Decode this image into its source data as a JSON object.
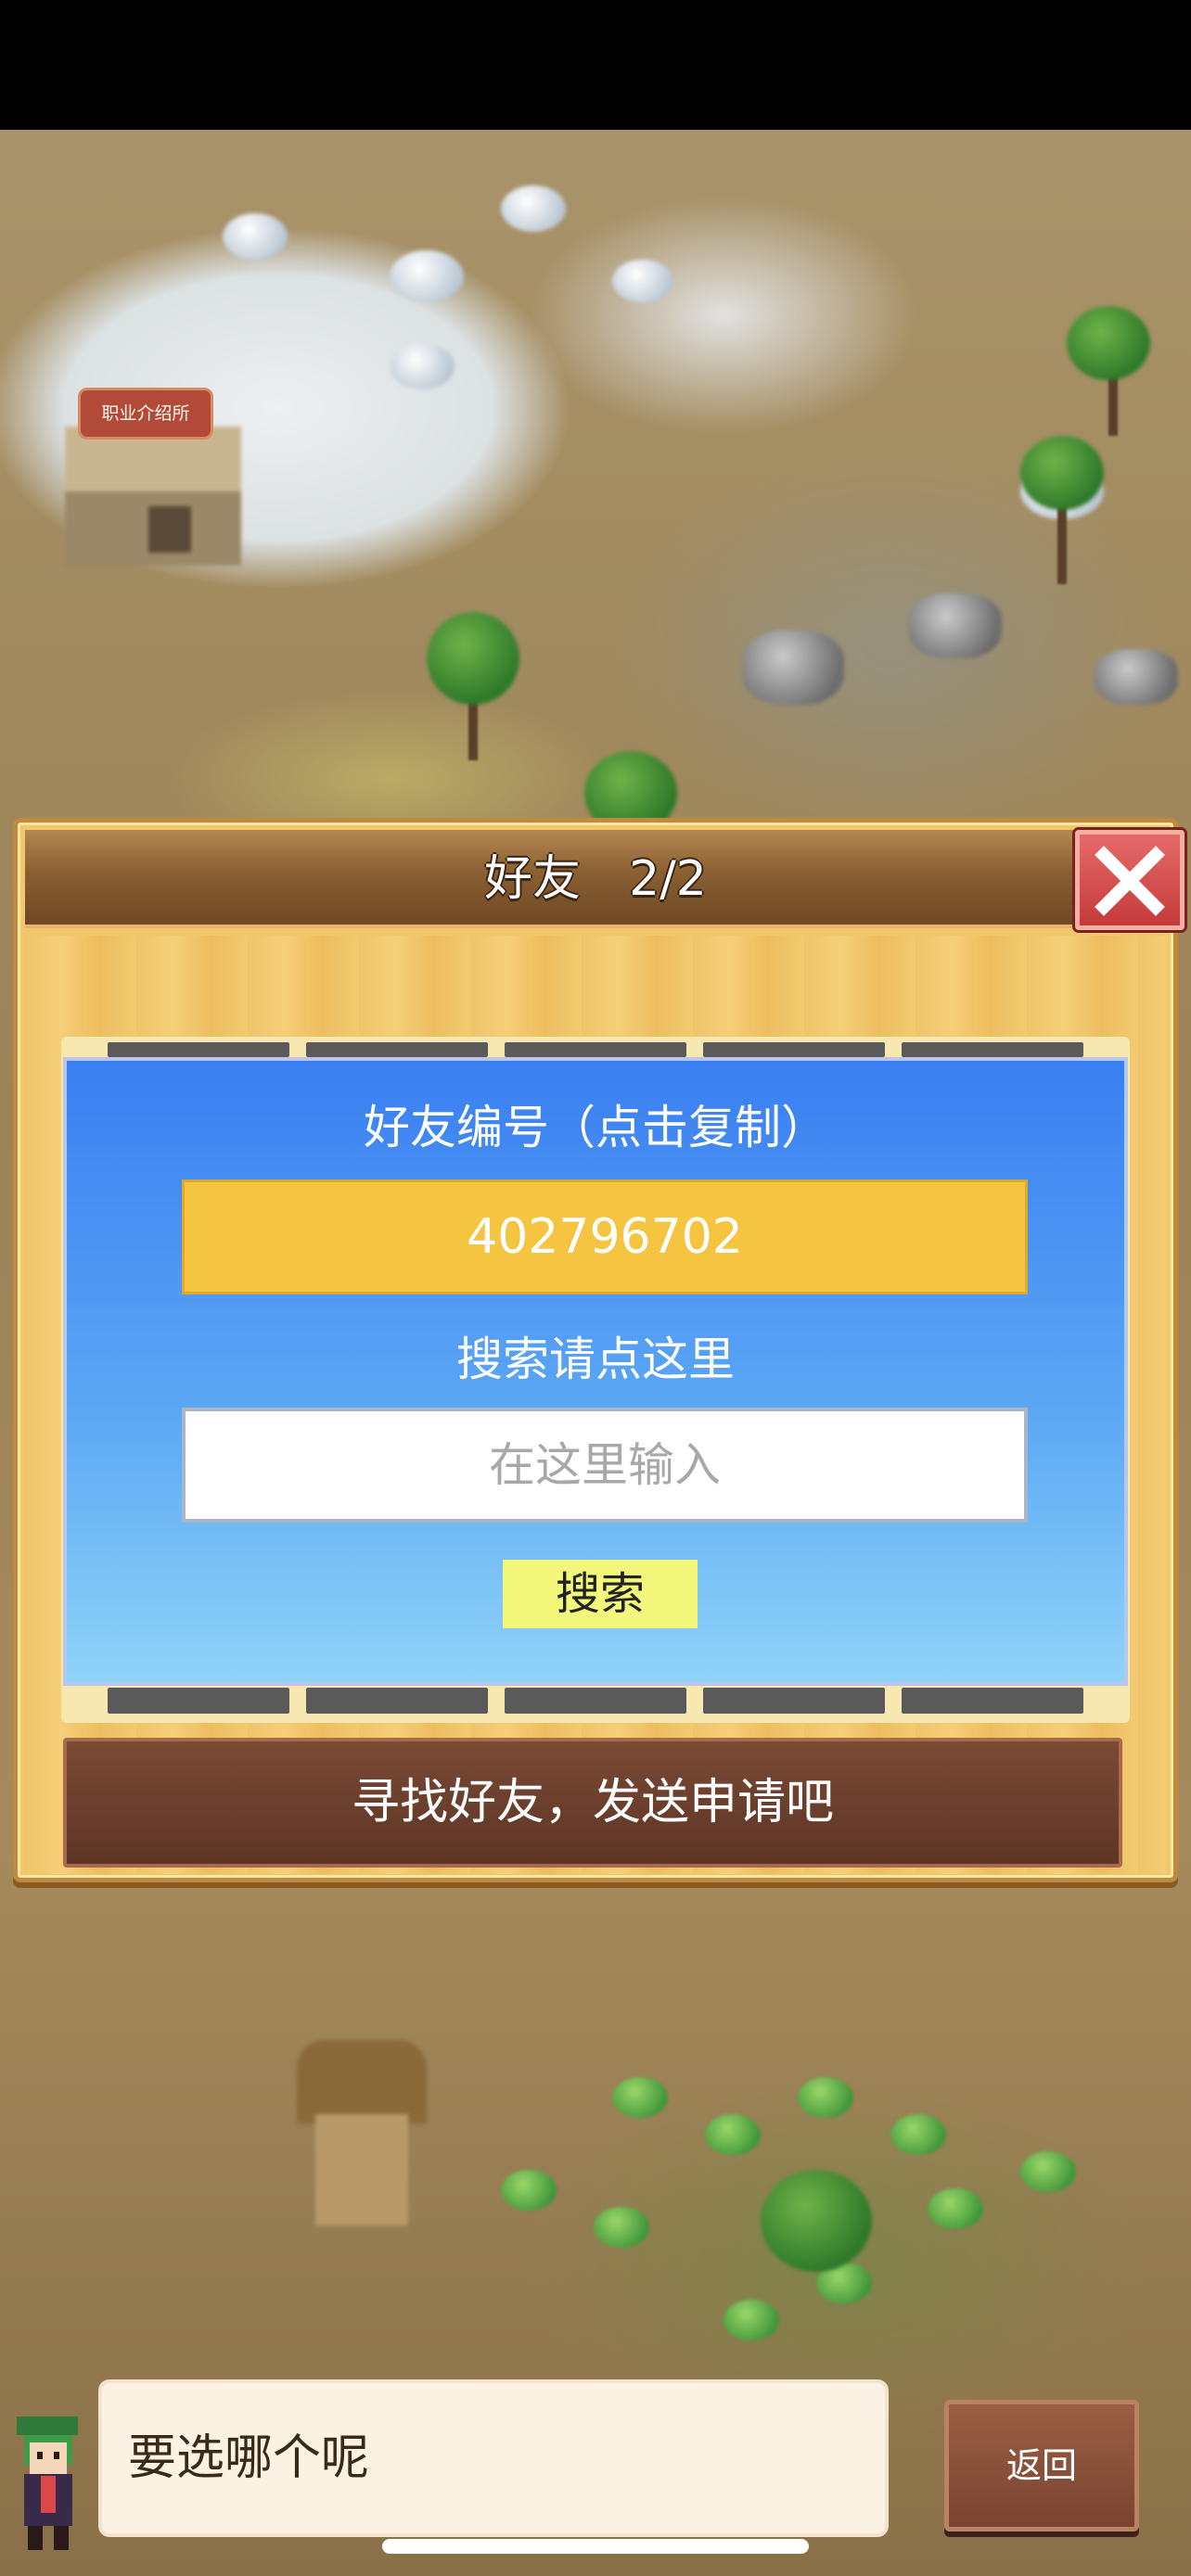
{
  "map": {
    "building_sign": "职业介绍所"
  },
  "dialog": {
    "title": "好友　2/2",
    "friend_id_label": "好友编号（点击复制）",
    "friend_id": "402796702",
    "search_label": "搜索请点这里",
    "search_placeholder": "在这里输入",
    "search_value": "",
    "search_button": "搜索",
    "find_banner": "寻找好友，发送申请吧"
  },
  "footer": {
    "speech": "要选哪个呢",
    "back_button": "返回"
  },
  "icons": {
    "close": "close-icon",
    "left_arrow": "arrow-left-icon",
    "right_arrow": "arrow-right-icon",
    "avatar": "character-avatar"
  },
  "colors": {
    "card_top": "#3a7ff2",
    "id_box": "#f5c542",
    "search_button": "#f3f87a",
    "banner": "#6a3e2c",
    "close_button": "#d9534f"
  }
}
